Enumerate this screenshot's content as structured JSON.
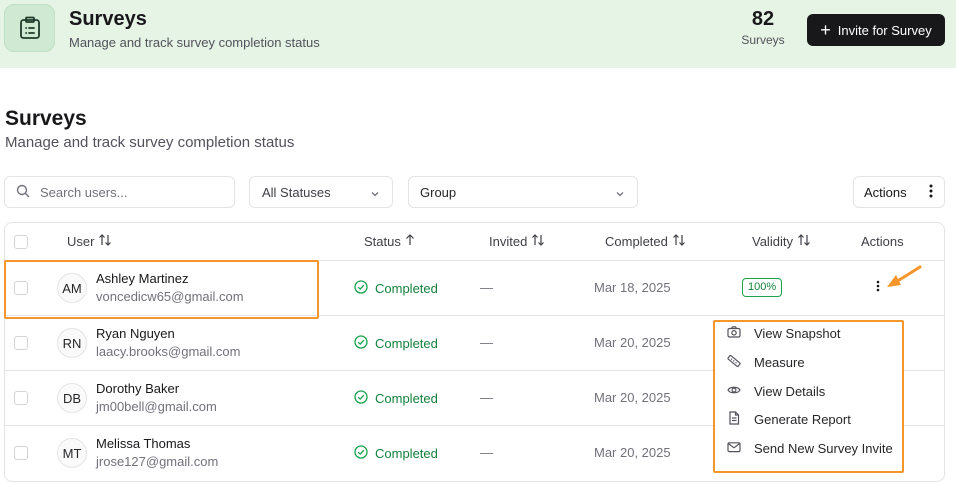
{
  "header": {
    "title": "Surveys",
    "subtitle": "Manage and track survey completion status",
    "count": "82",
    "count_label": "Surveys",
    "invite_label": "Invite for Survey"
  },
  "page": {
    "title": "Surveys",
    "subtitle": "Manage and track survey completion status"
  },
  "filters": {
    "search_placeholder": "Search users...",
    "status_value": "All Statuses",
    "group_value": "Group",
    "actions_label": "Actions"
  },
  "table": {
    "columns": {
      "user": "User",
      "status": "Status",
      "invited": "Invited",
      "completed": "Completed",
      "validity": "Validity",
      "actions": "Actions"
    },
    "rows": [
      {
        "initials": "AM",
        "name": "Ashley Martinez",
        "email": "voncedicw65@gmail.com",
        "status": "Completed",
        "invited": "—",
        "completed": "Mar 18, 2025",
        "validity": "100%"
      },
      {
        "initials": "RN",
        "name": "Ryan Nguyen",
        "email": "laacy.brooks@gmail.com",
        "status": "Completed",
        "invited": "—",
        "completed": "Mar 20, 2025",
        "validity": ""
      },
      {
        "initials": "DB",
        "name": "Dorothy Baker",
        "email": "jm00bell@gmail.com",
        "status": "Completed",
        "invited": "—",
        "completed": "Mar 20, 2025",
        "validity": ""
      },
      {
        "initials": "MT",
        "name": "Melissa Thomas",
        "email": "jrose127@gmail.com",
        "status": "Completed",
        "invited": "—",
        "completed": "Mar 20, 2025",
        "validity": ""
      }
    ]
  },
  "menu": {
    "items": [
      {
        "label": "View Snapshot",
        "icon": "camera-icon"
      },
      {
        "label": "Measure",
        "icon": "ruler-icon"
      },
      {
        "label": "View Details",
        "icon": "eye-icon"
      },
      {
        "label": "Generate Report",
        "icon": "document-icon"
      },
      {
        "label": "Send New Survey Invite",
        "icon": "mail-icon"
      }
    ]
  },
  "colors": {
    "header_bg": "#e6f4e6",
    "accent_green": "#15803d",
    "highlight_orange": "#f5962b",
    "button_dark": "#18181b"
  }
}
